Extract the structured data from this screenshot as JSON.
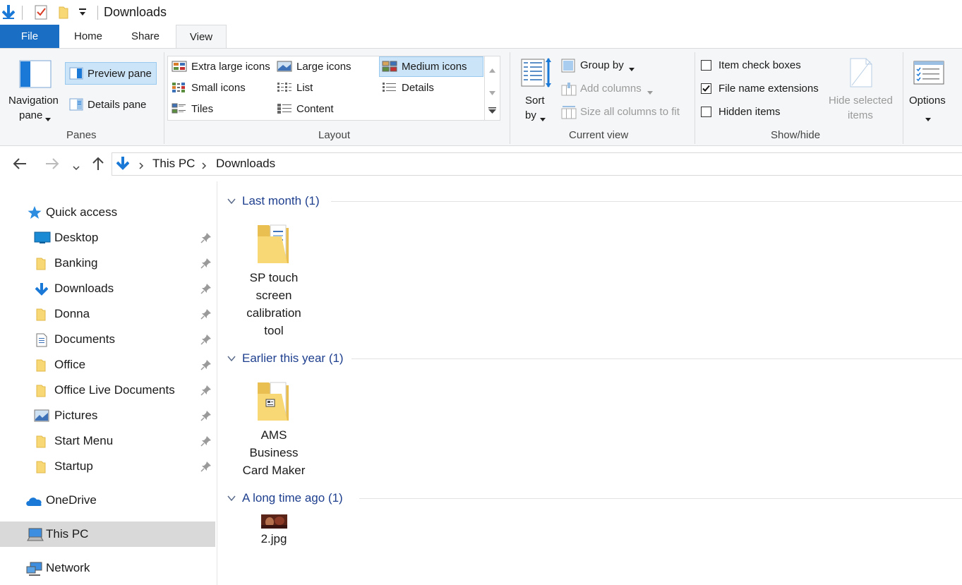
{
  "window": {
    "title": "Downloads"
  },
  "tabs": {
    "file": "File",
    "home": "Home",
    "share": "Share",
    "view": "View"
  },
  "ribbon": {
    "panes": {
      "navigation_pane_l1": "Navigation",
      "navigation_pane_l2": "pane",
      "preview_pane": "Preview pane",
      "details_pane": "Details pane",
      "group_label": "Panes"
    },
    "layout": {
      "extra_large_icons": "Extra large icons",
      "large_icons": "Large icons",
      "medium_icons": "Medium icons",
      "small_icons": "Small icons",
      "list": "List",
      "details": "Details",
      "tiles": "Tiles",
      "content": "Content",
      "selected": "Medium icons",
      "group_label": "Layout"
    },
    "current_view": {
      "sort_by_l1": "Sort",
      "sort_by_l2": "by",
      "group_by": "Group by",
      "add_columns": "Add columns",
      "size_all_columns": "Size all columns to fit",
      "group_label": "Current view"
    },
    "show_hide": {
      "item_check_boxes": "Item check boxes",
      "file_name_extensions": "File name extensions",
      "hidden_items": "Hidden items",
      "checked": {
        "item_check_boxes": false,
        "file_name_extensions": true,
        "hidden_items": false
      },
      "hide_selected_l1": "Hide selected",
      "hide_selected_l2": "items",
      "group_label": "Show/hide"
    },
    "options": {
      "label": "Options"
    }
  },
  "address": {
    "crumbs": [
      "This PC",
      "Downloads"
    ]
  },
  "sidebar": {
    "quick_access": "Quick access",
    "items": [
      {
        "label": "Desktop",
        "icon": "desktop-icon"
      },
      {
        "label": "Banking",
        "icon": "folder-icon"
      },
      {
        "label": "Downloads",
        "icon": "download-icon"
      },
      {
        "label": "Donna",
        "icon": "folder-icon"
      },
      {
        "label": "Documents",
        "icon": "documents-icon"
      },
      {
        "label": "Office",
        "icon": "folder-icon"
      },
      {
        "label": "Office Live Documents",
        "icon": "folder-icon"
      },
      {
        "label": "Pictures",
        "icon": "pictures-icon"
      },
      {
        "label": "Start Menu",
        "icon": "folder-icon"
      },
      {
        "label": "Startup",
        "icon": "folder-icon"
      }
    ],
    "onedrive": "OneDrive",
    "this_pc": "This PC",
    "network": "Network"
  },
  "content": {
    "groups": [
      {
        "title": "Last month (1)",
        "files": [
          {
            "lines": [
              "SP touch",
              "screen",
              "calibration",
              "tool"
            ]
          }
        ]
      },
      {
        "title": "Earlier this year (1)",
        "files": [
          {
            "lines": [
              "AMS",
              "Business",
              "Card Maker"
            ]
          }
        ]
      },
      {
        "title": "A long time ago (1)",
        "files": [
          {
            "lines": [
              "2.jpg"
            ]
          }
        ]
      }
    ]
  },
  "colors": {
    "accent": "#1a6fc4",
    "selection": "#cce4f7",
    "group_header": "#1e3f8e",
    "folder": "#f8d775"
  }
}
